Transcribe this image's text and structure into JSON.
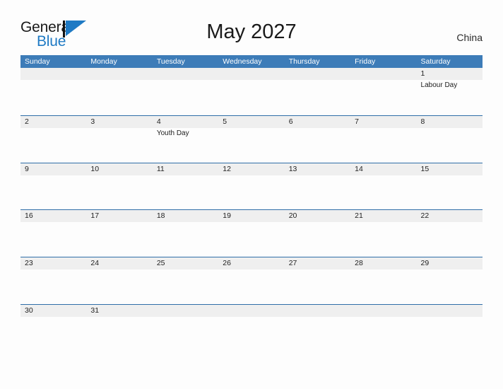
{
  "brand": {
    "name_part1": "General",
    "name_part2": "Blue",
    "logo_icon": "general-blue-triangle-logo"
  },
  "header": {
    "title": "May 2027",
    "country": "China"
  },
  "calendar": {
    "month": "May",
    "year": "2027",
    "weekday_headers": [
      "Sunday",
      "Monday",
      "Tuesday",
      "Wednesday",
      "Thursday",
      "Friday",
      "Saturday"
    ],
    "colors": {
      "header_blue": "#3d7cb8",
      "row_divider_blue": "#2f6ea8",
      "date_strip_gray": "#efefef",
      "page_background": "#fdfdfd",
      "brand_blue": "#1f7ac4"
    },
    "weeks": [
      [
        {
          "day": "",
          "event": ""
        },
        {
          "day": "",
          "event": ""
        },
        {
          "day": "",
          "event": ""
        },
        {
          "day": "",
          "event": ""
        },
        {
          "day": "",
          "event": ""
        },
        {
          "day": "",
          "event": ""
        },
        {
          "day": "1",
          "event": "Labour Day"
        }
      ],
      [
        {
          "day": "2",
          "event": ""
        },
        {
          "day": "3",
          "event": ""
        },
        {
          "day": "4",
          "event": "Youth Day"
        },
        {
          "day": "5",
          "event": ""
        },
        {
          "day": "6",
          "event": ""
        },
        {
          "day": "7",
          "event": ""
        },
        {
          "day": "8",
          "event": ""
        }
      ],
      [
        {
          "day": "9",
          "event": ""
        },
        {
          "day": "10",
          "event": ""
        },
        {
          "day": "11",
          "event": ""
        },
        {
          "day": "12",
          "event": ""
        },
        {
          "day": "13",
          "event": ""
        },
        {
          "day": "14",
          "event": ""
        },
        {
          "day": "15",
          "event": ""
        }
      ],
      [
        {
          "day": "16",
          "event": ""
        },
        {
          "day": "17",
          "event": ""
        },
        {
          "day": "18",
          "event": ""
        },
        {
          "day": "19",
          "event": ""
        },
        {
          "day": "20",
          "event": ""
        },
        {
          "day": "21",
          "event": ""
        },
        {
          "day": "22",
          "event": ""
        }
      ],
      [
        {
          "day": "23",
          "event": ""
        },
        {
          "day": "24",
          "event": ""
        },
        {
          "day": "25",
          "event": ""
        },
        {
          "day": "26",
          "event": ""
        },
        {
          "day": "27",
          "event": ""
        },
        {
          "day": "28",
          "event": ""
        },
        {
          "day": "29",
          "event": ""
        }
      ],
      [
        {
          "day": "30",
          "event": ""
        },
        {
          "day": "31",
          "event": ""
        },
        {
          "day": "",
          "event": ""
        },
        {
          "day": "",
          "event": ""
        },
        {
          "day": "",
          "event": ""
        },
        {
          "day": "",
          "event": ""
        },
        {
          "day": "",
          "event": ""
        }
      ]
    ]
  }
}
